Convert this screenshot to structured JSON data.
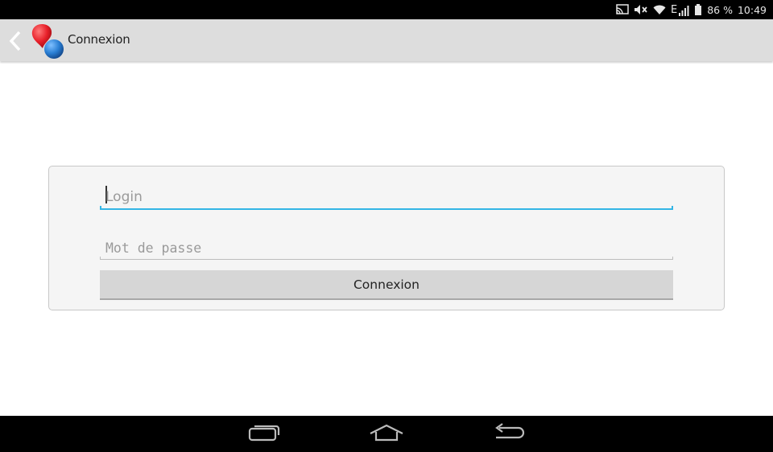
{
  "status_bar": {
    "battery_percent": "86 %",
    "time": "10:49",
    "network_type": "E",
    "icons": [
      "cast-icon",
      "mute-icon",
      "wifi-icon",
      "signal-icon",
      "battery-icon"
    ]
  },
  "action_bar": {
    "title": "Connexion",
    "icons": [
      "back-chevron-icon",
      "app-logo-icon"
    ],
    "logo_colors": [
      "#e8202a",
      "#2a7fd4"
    ]
  },
  "form": {
    "login_placeholder": "Login",
    "password_placeholder": "Mot de passe",
    "submit_label": "Connexion",
    "focus_color": "#33b5e5"
  },
  "nav_bar": {
    "icons": [
      "recent-apps-icon",
      "home-icon",
      "back-icon"
    ]
  }
}
